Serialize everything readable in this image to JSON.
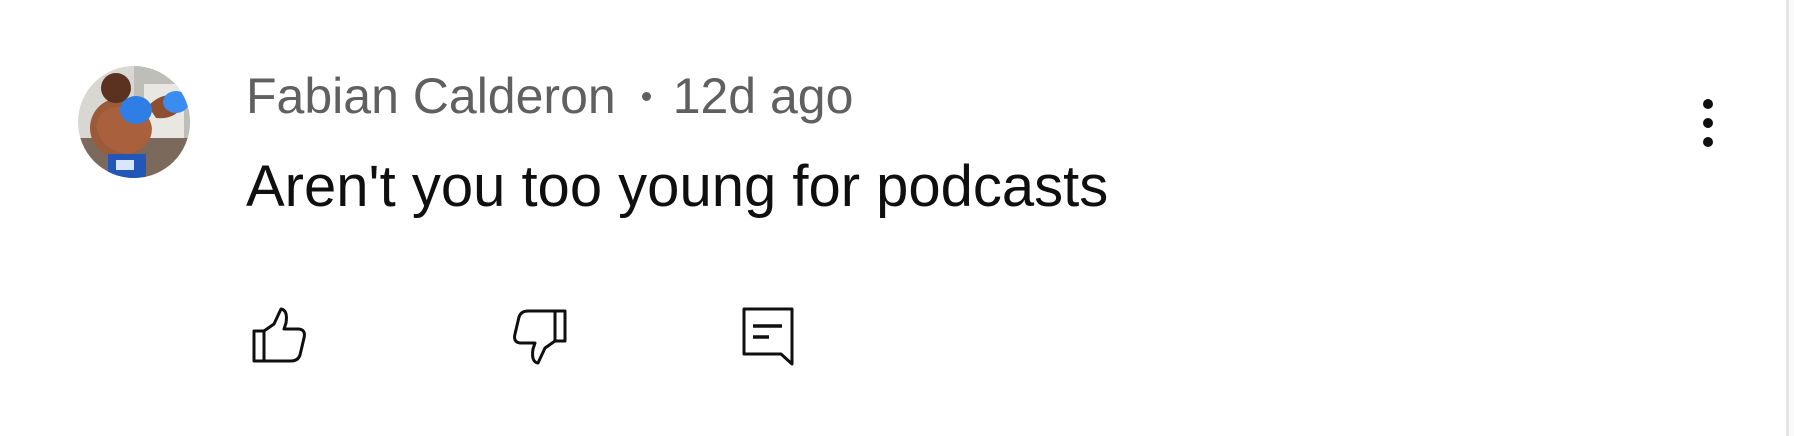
{
  "comment": {
    "author": "Fabian Calderon",
    "time": "12d ago",
    "text": "Aren't you too young for podcasts"
  },
  "icons": {
    "avatar": "avatar-photo",
    "more": "more-vertical-icon",
    "like": "thumb-up-icon",
    "dislike": "thumb-down-icon",
    "reply": "reply-comment-icon"
  },
  "colors": {
    "author_text": "#606060",
    "comment_text": "#0f0f0f",
    "icon": "#0f0f0f"
  }
}
